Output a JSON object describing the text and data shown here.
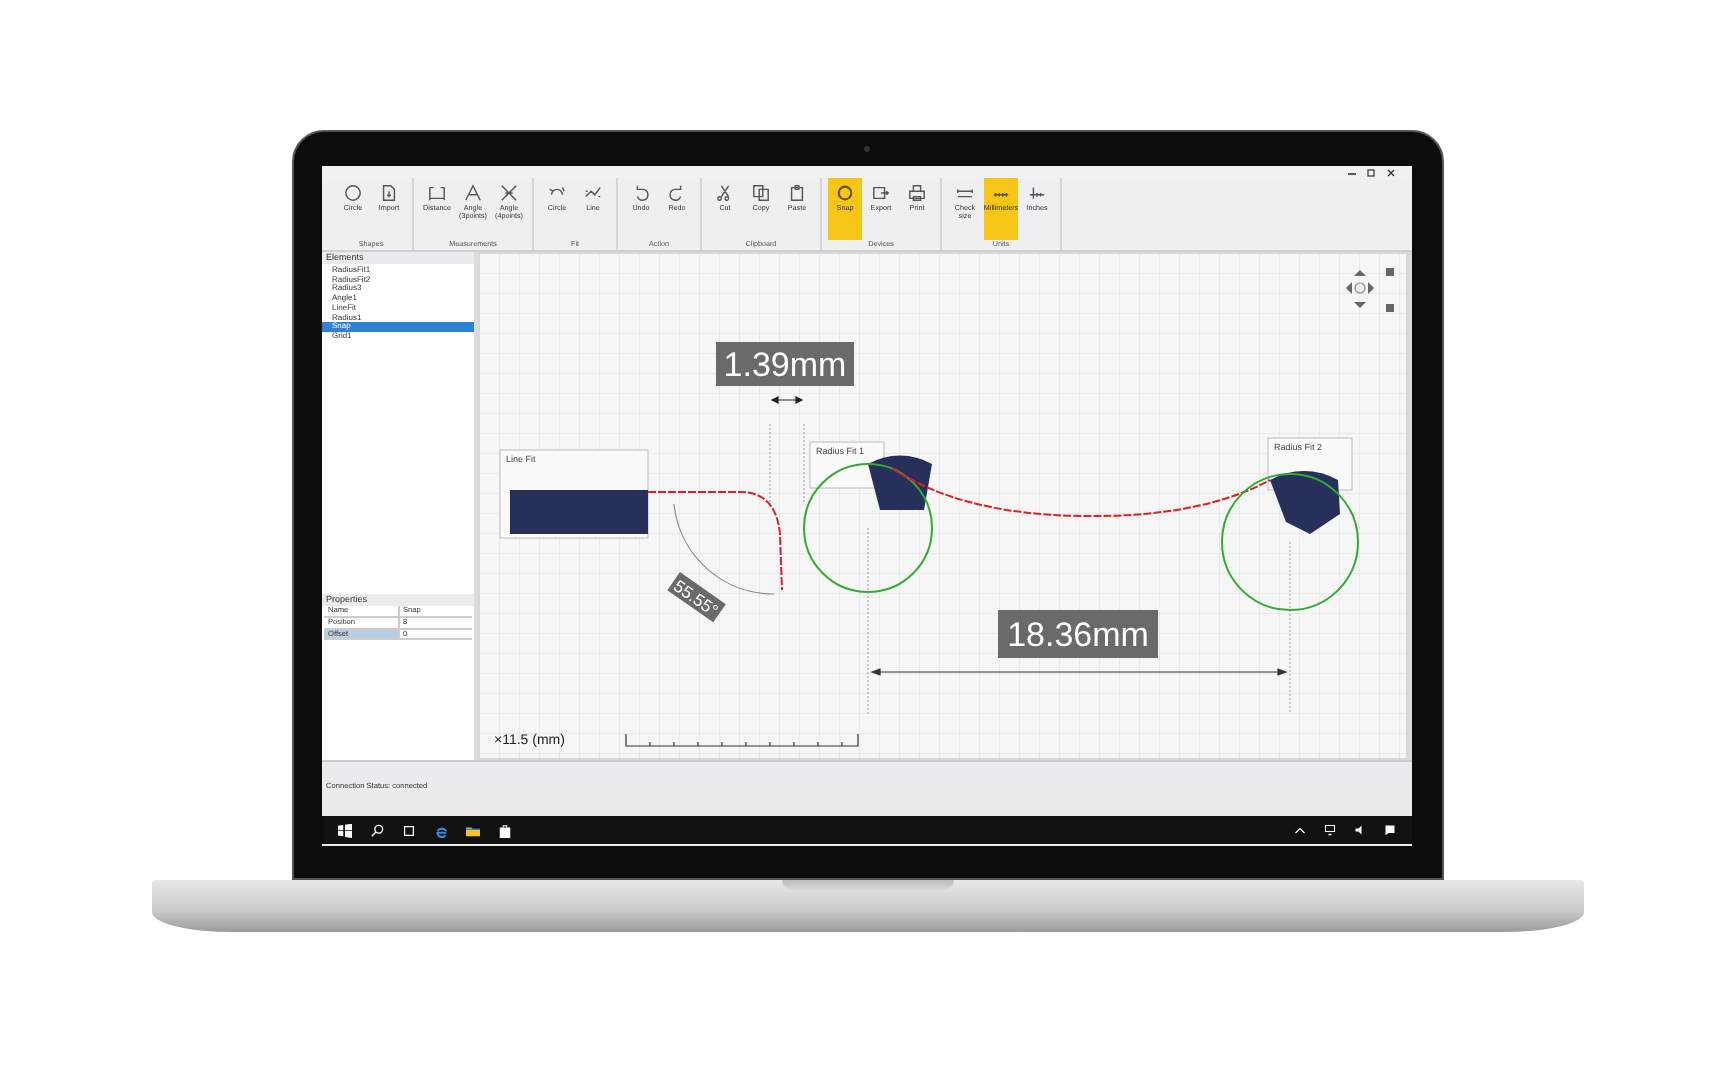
{
  "ribbon": {
    "groups": [
      {
        "label": "Shapes",
        "buttons": [
          {
            "label": "Circle",
            "kind": "circle",
            "selected": false
          },
          {
            "label": "Import",
            "kind": "import",
            "selected": false
          }
        ]
      },
      {
        "label": "Measurements",
        "buttons": [
          {
            "label": "Distance",
            "kind": "distance",
            "selected": false
          },
          {
            "label": "Angle (3points)",
            "kind": "angle",
            "selected": false
          },
          {
            "label": "Angle (4points)",
            "kind": "cross",
            "selected": false
          }
        ]
      },
      {
        "label": "Fit",
        "buttons": [
          {
            "label": "Circle",
            "kind": "circlefit",
            "selected": false
          },
          {
            "label": "Line",
            "kind": "linefit",
            "selected": false
          }
        ]
      },
      {
        "label": "Action",
        "buttons": [
          {
            "label": "Undo",
            "kind": "undo",
            "selected": false
          },
          {
            "label": "Redo",
            "kind": "redo",
            "selected": false
          }
        ]
      },
      {
        "label": "Clipboard",
        "buttons": [
          {
            "label": "Cut",
            "kind": "cut",
            "selected": false
          },
          {
            "label": "Copy",
            "kind": "copy",
            "selected": false
          },
          {
            "label": "Paste",
            "kind": "paste",
            "selected": false
          }
        ]
      },
      {
        "label": "Devices",
        "buttons": [
          {
            "label": "Snap",
            "kind": "snap",
            "selected": true
          },
          {
            "label": "Export",
            "kind": "export",
            "selected": false
          },
          {
            "label": "Print",
            "kind": "print",
            "selected": false
          }
        ]
      },
      {
        "label": "Units",
        "buttons": [
          {
            "label": "Check size",
            "kind": "check",
            "selected": false
          },
          {
            "label": "Millimeters",
            "kind": "mm",
            "selected": true
          },
          {
            "label": "Inches",
            "kind": "inch",
            "selected": false
          }
        ]
      }
    ]
  },
  "elements": {
    "title": "Elements",
    "items": [
      {
        "label": "RadiusFit1",
        "selected": false
      },
      {
        "label": "RadiusFit2",
        "selected": false
      },
      {
        "label": "Radius3",
        "selected": false
      },
      {
        "label": "Angle1",
        "selected": false
      },
      {
        "label": "LineFit",
        "selected": false
      },
      {
        "label": "Radius1",
        "selected": false
      },
      {
        "label": "Snap",
        "selected": true
      },
      {
        "label": "Grid1",
        "selected": false
      }
    ]
  },
  "properties": {
    "title": "Properties",
    "rows": [
      {
        "name": "Name",
        "value": "Snap",
        "selected": false
      },
      {
        "name": "Position",
        "value": "8",
        "selected": false
      },
      {
        "name": "Offset",
        "value": "0",
        "selected": true
      }
    ]
  },
  "canvas": {
    "fit_boxes": [
      "Line Fit",
      "Radius Fit 1",
      "Radius Fit 2"
    ],
    "distance_labels": [
      "1.39mm",
      "18.36mm"
    ],
    "angle_label": "55.55°",
    "zoom_label": "×11.5 (mm)"
  },
  "status_bar": {
    "text": "Connection Status: connected"
  }
}
